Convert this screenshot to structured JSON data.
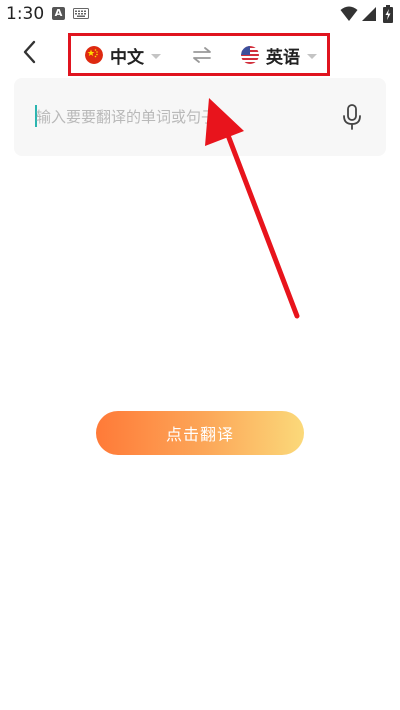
{
  "status_bar": {
    "time": "1:30",
    "a_icon_letter": "A"
  },
  "header": {
    "source_language": "中文",
    "target_language": "英语"
  },
  "input": {
    "placeholder": "输入要要翻译的单词或句子",
    "value": ""
  },
  "actions": {
    "translate_label": "点击翻译"
  },
  "colors": {
    "highlight_box": "#e0141f",
    "annotation_arrow": "#e8141c",
    "button_gradient_start": "#ff7a38",
    "button_gradient_end": "#fbd97a",
    "cursor": "#2bb5b0"
  },
  "icons": {
    "back": "chevron-left-icon",
    "swap": "swap-arrows-icon",
    "mic": "microphone-icon",
    "source_flag": "china-flag-icon",
    "target_flag": "usa-flag-icon"
  }
}
